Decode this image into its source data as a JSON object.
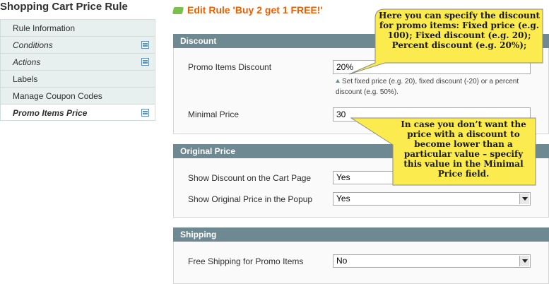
{
  "sidebar": {
    "title": "Shopping Cart Price Rule",
    "items": [
      {
        "label": "Rule Information"
      },
      {
        "label": "Conditions"
      },
      {
        "label": "Actions"
      },
      {
        "label": "Labels"
      },
      {
        "label": "Manage Coupon Codes"
      },
      {
        "label": "Promo Items Price"
      }
    ]
  },
  "header": {
    "title": "Edit Rule 'Buy 2 get 1 FREE!'"
  },
  "discount": {
    "heading": "Discount",
    "promo_label": "Promo Items Discount",
    "promo_value": "20%",
    "note": "Set fixed price (e.g. 20), fixed discount (-20) or a percent discount (e.g. 50%).",
    "min_label": "Minimal Price",
    "min_value": "30"
  },
  "original_price": {
    "heading": "Original Price",
    "cart_label": "Show Discount on the Cart Page",
    "cart_value": "Yes",
    "popup_label": "Show Original Price in the Popup",
    "popup_value": "Yes"
  },
  "shipping": {
    "heading": "Shipping",
    "free_label": "Free Shipping for Promo Items",
    "free_value": "No"
  },
  "callouts": {
    "top": "Here you can specify the discount for promo items: Fixed price (e.g. 100); Fixed discount (e.g. 20); Percent discount (e.g. 20%);",
    "bottom": "In case you don’t want the price with a discount to become  lower than a particular value – specify this value in the Minimal Price field."
  },
  "colors": {
    "accent": "#eb5e00",
    "section_header": "#6f8992",
    "callout_fill": "#fbeb4e"
  },
  "icons": {
    "title": "edit-rule-icon",
    "tab_changed": "changed-tab-icon",
    "select": "dropdown-arrow-icon",
    "note": "note-arrow-icon"
  }
}
